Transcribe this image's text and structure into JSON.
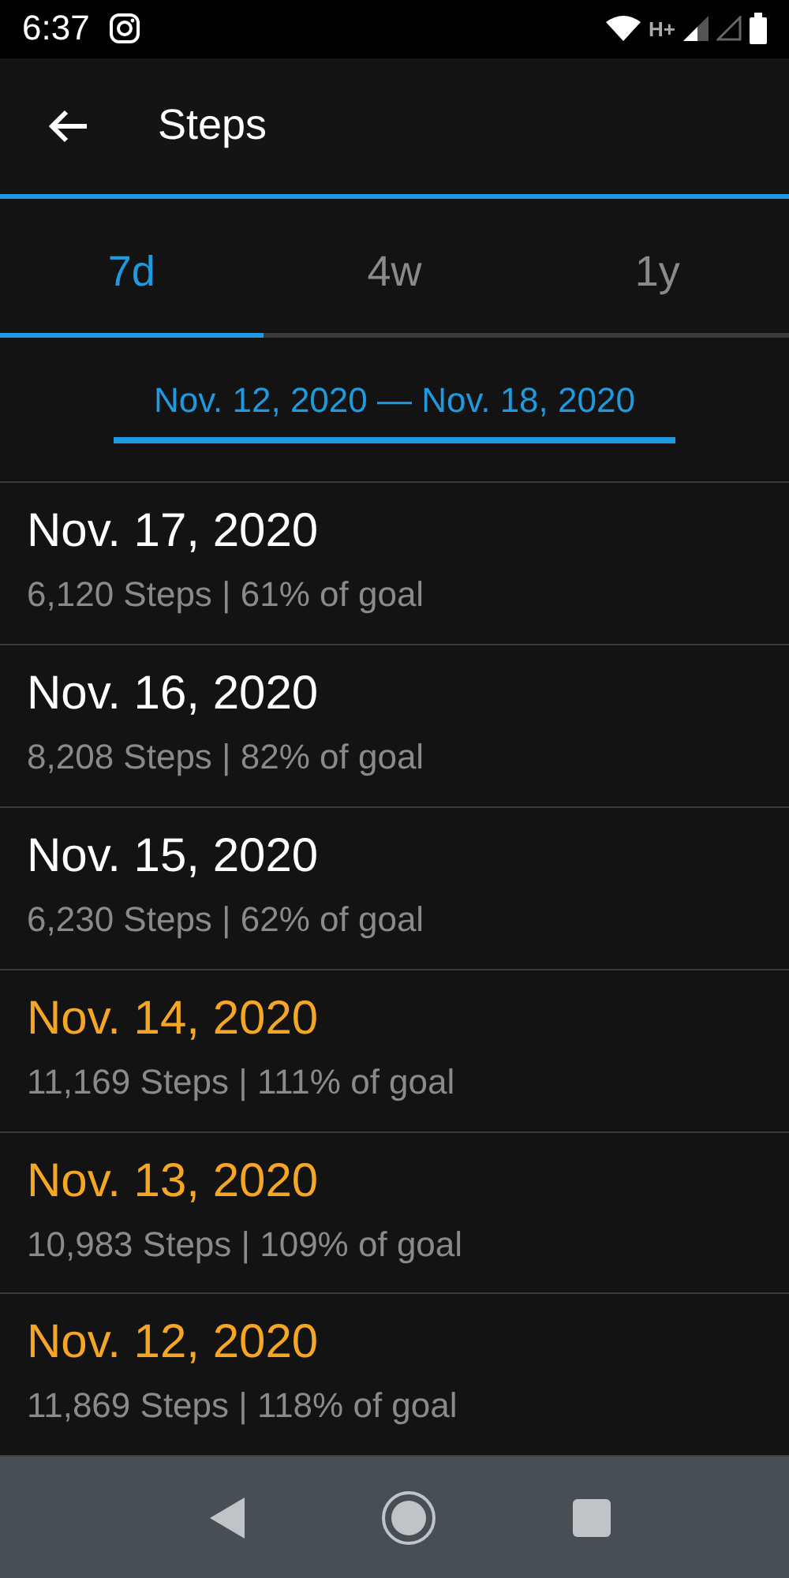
{
  "status_bar": {
    "time": "6:37",
    "network": "H+"
  },
  "app_bar": {
    "title": "Steps"
  },
  "tabs": [
    {
      "label": "7d",
      "selected": true
    },
    {
      "label": "4w",
      "selected": false
    },
    {
      "label": "1y",
      "selected": false
    }
  ],
  "date_range": "Nov. 12, 2020 — Nov. 18, 2020",
  "days": [
    {
      "date": "Nov. 17, 2020",
      "detail": "6,120 Steps | 61% of goal",
      "goal_met": false
    },
    {
      "date": "Nov. 16, 2020",
      "detail": "8,208 Steps | 82% of goal",
      "goal_met": false
    },
    {
      "date": "Nov. 15, 2020",
      "detail": "6,230 Steps | 62% of goal",
      "goal_met": false
    },
    {
      "date": "Nov. 14, 2020",
      "detail": "11,169 Steps | 111% of goal",
      "goal_met": true
    },
    {
      "date": "Nov. 13, 2020",
      "detail": "10,983 Steps | 109% of goal",
      "goal_met": true
    },
    {
      "date": "Nov. 12, 2020",
      "detail": "11,869 Steps | 118% of goal",
      "goal_met": true
    }
  ]
}
